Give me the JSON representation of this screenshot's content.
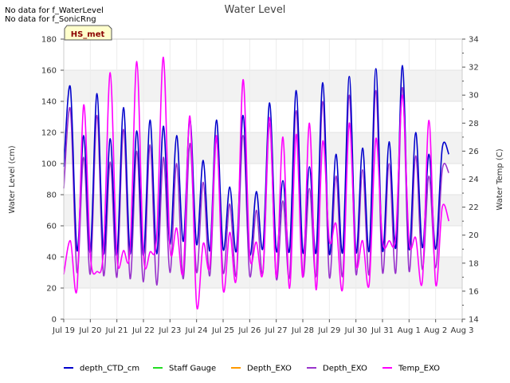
{
  "notices": [
    "No data for f_WaterLevel",
    "No data for f_SonicRng"
  ],
  "badge": "HS_met",
  "chart_data": {
    "type": "line",
    "title": "Water Level",
    "ylabel": "Water Level (cm)",
    "y2label": "Water Temp (C)",
    "ylim": [
      0,
      180
    ],
    "y2lim": [
      14,
      34
    ],
    "yticks": [
      0,
      20,
      40,
      60,
      80,
      100,
      120,
      140,
      160,
      180
    ],
    "y2ticks": [
      14,
      16,
      18,
      20,
      22,
      24,
      26,
      28,
      30,
      32,
      34
    ],
    "xlim": [
      0,
      15
    ],
    "xticks": [
      "Jul 19",
      "Jul 20",
      "Jul 21",
      "Jul 22",
      "Jul 23",
      "Jul 24",
      "Jul 25",
      "Jul 26",
      "Jul 27",
      "Jul 28",
      "Jul 29",
      "Jul 30",
      "Jul 31",
      "Aug 1",
      "Aug 2",
      "Aug 3"
    ],
    "grid": true,
    "legend_position": "bottom",
    "series": [
      {
        "name": "depth_CTD_cm",
        "color": "#0000cc",
        "axis": "left",
        "x": [
          0.0,
          0.25,
          0.5,
          0.75,
          1.0,
          1.25,
          1.5,
          1.75,
          2.0,
          2.25,
          2.5,
          2.75,
          3.0,
          3.25,
          3.5,
          3.75,
          4.0,
          4.25,
          4.5,
          4.75,
          5.0,
          5.25,
          5.5,
          5.75,
          6.0,
          6.25,
          6.5,
          6.75,
          7.0,
          7.25,
          7.5,
          7.75,
          8.0,
          8.25,
          8.5,
          8.75,
          9.0,
          9.25,
          9.5,
          9.75,
          10.0,
          10.25,
          10.5,
          10.75,
          11.0,
          11.25,
          11.5,
          11.75,
          12.0,
          12.25,
          12.5,
          12.75,
          13.0,
          13.25,
          13.5,
          13.75,
          14.0,
          14.25,
          14.5
        ],
        "values": [
          98,
          149,
          44,
          118,
          43,
          145,
          42,
          116,
          41,
          136,
          42,
          121,
          41,
          128,
          42,
          124,
          48,
          118,
          50,
          129,
          48,
          102,
          44,
          128,
          45,
          85,
          44,
          131,
          42,
          82,
          46,
          139,
          44,
          89,
          44,
          147,
          43,
          98,
          43,
          152,
          42,
          106,
          43,
          156,
          43,
          110,
          44,
          161,
          44,
          114,
          46,
          163,
          45,
          120,
          46,
          106,
          45,
          110,
          106
        ]
      },
      {
        "name": "Staff Gauge",
        "color": "#22dd22",
        "axis": "left",
        "x": [],
        "values": []
      },
      {
        "name": "Depth_EXO",
        "color": "#ff9900",
        "axis": "left",
        "x": [],
        "values": []
      },
      {
        "name": "Depth_EXO",
        "color": "#9933cc",
        "axis": "left",
        "x": [
          0.0,
          0.25,
          0.5,
          0.75,
          1.0,
          1.25,
          1.5,
          1.75,
          2.0,
          2.25,
          2.5,
          2.75,
          3.0,
          3.25,
          3.5,
          3.75,
          4.0,
          4.25,
          4.5,
          4.75,
          5.0,
          5.25,
          5.5,
          5.75,
          6.0,
          6.25,
          6.5,
          6.75,
          7.0,
          7.25,
          7.5,
          7.75,
          8.0,
          8.25,
          8.5,
          8.75,
          9.0,
          9.25,
          9.5,
          9.75,
          10.0,
          10.25,
          10.5,
          10.75,
          11.0,
          11.25,
          11.5,
          11.75,
          12.0,
          12.25,
          12.5,
          12.75,
          13.0,
          13.25,
          13.5,
          13.75,
          14.0,
          14.25,
          14.5
        ],
        "values": [
          84,
          135,
          30,
          104,
          29,
          131,
          28,
          101,
          27,
          122,
          26,
          108,
          24,
          112,
          22,
          104,
          30,
          100,
          26,
          113,
          30,
          88,
          28,
          116,
          30,
          74,
          28,
          118,
          28,
          70,
          30,
          126,
          26,
          76,
          27,
          134,
          28,
          84,
          28,
          140,
          27,
          92,
          28,
          144,
          29,
          96,
          29,
          147,
          30,
          100,
          30,
          149,
          31,
          105,
          32,
          92,
          33,
          96,
          94
        ]
      },
      {
        "name": "Temp_EXO",
        "color": "#ff00ff",
        "axis": "right",
        "x": [
          0.0,
          0.25,
          0.5,
          0.75,
          1.0,
          1.25,
          1.5,
          1.75,
          2.0,
          2.25,
          2.5,
          2.75,
          3.0,
          3.25,
          3.5,
          3.75,
          4.0,
          4.25,
          4.5,
          4.75,
          5.0,
          5.25,
          5.5,
          5.75,
          6.0,
          6.25,
          6.5,
          6.75,
          7.0,
          7.25,
          7.5,
          7.75,
          8.0,
          8.25,
          8.5,
          8.75,
          9.0,
          9.25,
          9.5,
          9.75,
          10.0,
          10.25,
          10.5,
          10.75,
          11.0,
          11.25,
          11.5,
          11.75,
          12.0,
          12.25,
          12.5,
          12.75,
          13.0,
          13.25,
          13.5,
          13.75,
          14.0,
          14.25,
          14.5
        ],
        "values": [
          17.2,
          19.6,
          16.2,
          29.3,
          18.6,
          17.4,
          19.0,
          31.6,
          18.5,
          18.9,
          19.0,
          32.4,
          18.6,
          18.8,
          20.0,
          32.7,
          19.1,
          20.5,
          17.4,
          28.5,
          15.0,
          19.4,
          17.8,
          27.1,
          16.1,
          20.2,
          17.0,
          31.1,
          18.6,
          19.5,
          17.4,
          28.4,
          17.0,
          27.0,
          16.2,
          27.2,
          17.0,
          28.0,
          16.1,
          26.7,
          19.6,
          20.8,
          16.2,
          28.0,
          18.0,
          19.6,
          16.5,
          26.9,
          19.6,
          19.6,
          20.0,
          30.0,
          19.6,
          19.8,
          16.7,
          28.2,
          16.5,
          22.0,
          21.0
        ]
      }
    ]
  }
}
